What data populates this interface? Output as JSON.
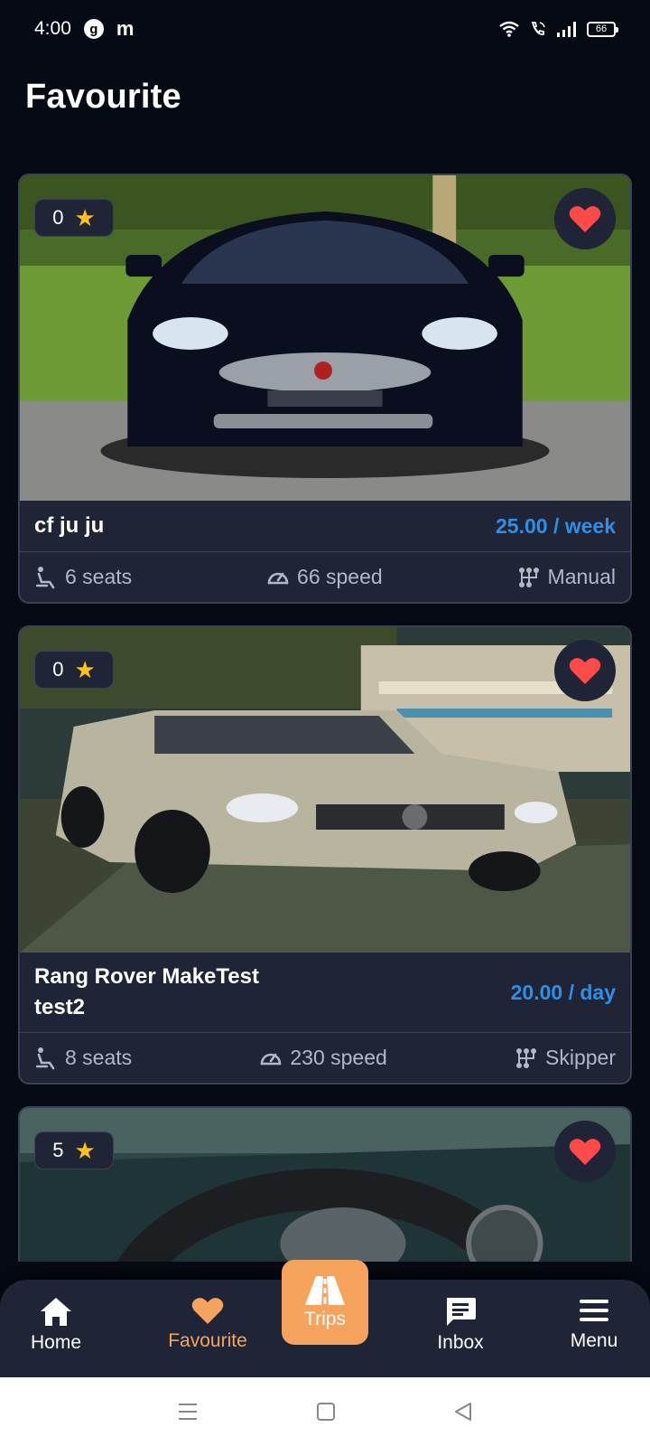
{
  "status_bar": {
    "time": "4:00",
    "g_badge": "g",
    "m_badge": "m",
    "battery": "66"
  },
  "page": {
    "title": "Favourite"
  },
  "cars": [
    {
      "rating": "0",
      "name": "cf ju ju",
      "price": "25.00 / week",
      "seats": "6 seats",
      "speed": "66 speed",
      "transmission": "Manual",
      "favourite": true
    },
    {
      "rating": "0",
      "name": "Rang Rover MakeTest test2",
      "price": "20.00 / day",
      "seats": "8 seats",
      "speed": "230 speed",
      "transmission": "Skipper",
      "favourite": true
    },
    {
      "rating": "5",
      "favourite": true
    }
  ],
  "bottom_nav": {
    "home": "Home",
    "favourite": "Favourite",
    "trips": "Trips",
    "inbox": "Inbox",
    "menu": "Menu"
  },
  "colors": {
    "accent": "#f6a35d",
    "price": "#2f8ee6",
    "heart": "#ff4a4a",
    "star": "#ffc21a",
    "card": "#1f2436"
  }
}
